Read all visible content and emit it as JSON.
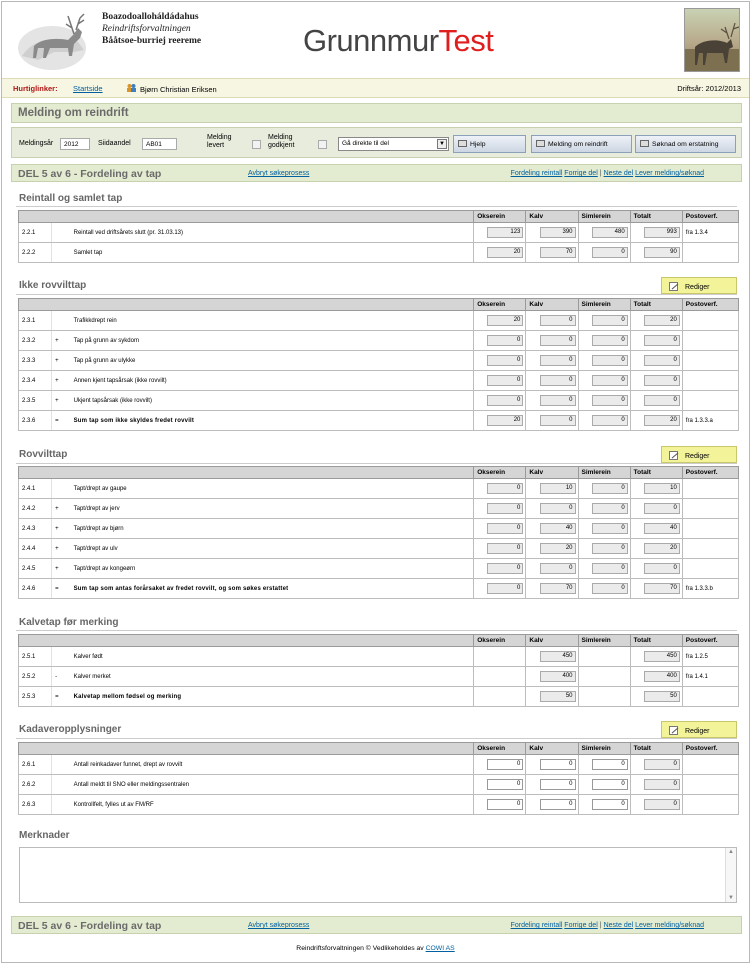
{
  "agency": {
    "line1": "Boazodoalloháldádahus",
    "line2": "Reindriftsforvaltningen",
    "line3": "Bååtsoe-burriej reereme"
  },
  "brand": {
    "part1": "Grunnmur",
    "part2": "Test"
  },
  "infobar": {
    "quicklinks_label": "Hurtiglinker:",
    "quicklinks_link": "Startside",
    "user_name": "Bjørn Christian Eriksen",
    "year_label": "Driftsår: 2012/2013"
  },
  "page_title": "Melding om reindrift",
  "controls": {
    "year_label": "Meldingsår",
    "year_value": "2012",
    "siida_label": "Siidaandel",
    "siida_value": "AB01",
    "delivered_label_1": "Melding",
    "delivered_label_2": "levert",
    "approved_label_1": "Melding",
    "approved_label_2": "godkjent",
    "goto_select": "Gå direkte til del",
    "help_button": "Hjelp",
    "report_button": "Melding om reindrift",
    "claim_button": "Søknad om erstatning"
  },
  "section_bar": {
    "title": "DEL 5 av 6 - Fordeling av tap",
    "cancel_link": "Avbryt søkeprosess",
    "nav_1": "Fordeling reintall",
    "nav_2": "Forrige del",
    "sep": "|",
    "nav_3": "Neste del",
    "nav_4": "Lever melding/søknad"
  },
  "edit_button_label": "Rediger",
  "columns": {
    "col1": "Okserein",
    "col2": "Kalv",
    "col3": "Simlerein",
    "col4": "Totalt",
    "col5": "Postoverf."
  },
  "sections": {
    "s1": {
      "heading": "Reintall og samlet tap",
      "rows": [
        {
          "code": "2.2.1",
          "op": "",
          "label": "Reintall ved driftsårets slutt (pr. 31.03.13)",
          "o": "123",
          "k": "390",
          "s": "480",
          "t": "993",
          "p": "fra 1.3.4"
        },
        {
          "code": "2.2.2",
          "op": "",
          "label": "Samlet tap",
          "o": "20",
          "k": "70",
          "s": "0",
          "t": "90",
          "p": ""
        }
      ]
    },
    "s2": {
      "heading": "Ikke rovvilttap",
      "rows": [
        {
          "code": "2.3.1",
          "op": "",
          "label": "Trafikkdrept rein",
          "o": "20",
          "k": "0",
          "s": "0",
          "t": "20",
          "p": ""
        },
        {
          "code": "2.3.2",
          "op": "+",
          "label": "Tap på grunn av sykdom",
          "o": "0",
          "k": "0",
          "s": "0",
          "t": "0",
          "p": ""
        },
        {
          "code": "2.3.3",
          "op": "+",
          "label": "Tap på grunn av ulykke",
          "o": "0",
          "k": "0",
          "s": "0",
          "t": "0",
          "p": ""
        },
        {
          "code": "2.3.4",
          "op": "+",
          "label": "Annen kjent tapsårsak (ikke rovvilt)",
          "o": "0",
          "k": "0",
          "s": "0",
          "t": "0",
          "p": ""
        },
        {
          "code": "2.3.5",
          "op": "+",
          "label": "Ukjent tapsårsak (ikke rovvilt)",
          "o": "0",
          "k": "0",
          "s": "0",
          "t": "0",
          "p": ""
        },
        {
          "code": "2.3.6",
          "op": "=",
          "label": "Sum tap som ikke skyldes fredet rovvilt",
          "o": "20",
          "k": "0",
          "s": "0",
          "t": "20",
          "p": "fra 1.3.3.a"
        }
      ]
    },
    "s3": {
      "heading": "Rovvilttap",
      "rows": [
        {
          "code": "2.4.1",
          "op": "",
          "label": "Tapt/drept av gaupe",
          "o": "0",
          "k": "10",
          "s": "0",
          "t": "10",
          "p": ""
        },
        {
          "code": "2.4.2",
          "op": "+",
          "label": "Tapt/drept av jerv",
          "o": "0",
          "k": "0",
          "s": "0",
          "t": "0",
          "p": ""
        },
        {
          "code": "2.4.3",
          "op": "+",
          "label": "Tapt/drept av bjørn",
          "o": "0",
          "k": "40",
          "s": "0",
          "t": "40",
          "p": ""
        },
        {
          "code": "2.4.4",
          "op": "+",
          "label": "Tapt/drept av ulv",
          "o": "0",
          "k": "20",
          "s": "0",
          "t": "20",
          "p": ""
        },
        {
          "code": "2.4.5",
          "op": "+",
          "label": "Tapt/drept av kongeørn",
          "o": "0",
          "k": "0",
          "s": "0",
          "t": "0",
          "p": ""
        },
        {
          "code": "2.4.6",
          "op": "=",
          "label": "Sum tap som antas forårsaket av fredet rovvilt, og som søkes erstattet",
          "o": "0",
          "k": "70",
          "s": "0",
          "t": "70",
          "p": "fra 1.3.3.b"
        }
      ]
    },
    "s4": {
      "heading": "Kalvetap før merking",
      "rows": [
        {
          "code": "2.5.1",
          "op": "",
          "label": "Kalver født",
          "o": "",
          "k": "450",
          "s": "",
          "t": "450",
          "p": "fra 1.2.5"
        },
        {
          "code": "2.5.2",
          "op": "-",
          "label": "Kalver merket",
          "o": "",
          "k": "400",
          "s": "",
          "t": "400",
          "p": "fra 1.4.1"
        },
        {
          "code": "2.5.3",
          "op": "=",
          "label": "Kalvetap mellom fødsel og merking",
          "o": "",
          "k": "50",
          "s": "",
          "t": "50",
          "p": ""
        }
      ]
    },
    "s5": {
      "heading": "Kadaveropplysninger",
      "rows": [
        {
          "code": "2.6.1",
          "op": "",
          "label": "Antall reinkadaver funnet, drept av rovvilt",
          "o": "0",
          "k": "0",
          "s": "0",
          "t": "0",
          "p": ""
        },
        {
          "code": "2.6.2",
          "op": "",
          "label": "Antall meldt til SNO eller meldingssentralen",
          "o": "0",
          "k": "0",
          "s": "0",
          "t": "0",
          "p": ""
        },
        {
          "code": "2.6.3",
          "op": "",
          "label": "Kontrollfelt, fylles ut av FM/RF",
          "o": "0",
          "k": "0",
          "s": "0",
          "t": "0",
          "p": ""
        }
      ]
    }
  },
  "remarks_heading": "Merknader",
  "footer": {
    "text": "Reindriftsforvaltningen © Vedlikeholdes av",
    "link": "COWI AS"
  },
  "colors": {
    "accent_red": "#e01e1e",
    "bar_green": "#e3ebd1",
    "edit_yellow": "#f3f49a"
  }
}
